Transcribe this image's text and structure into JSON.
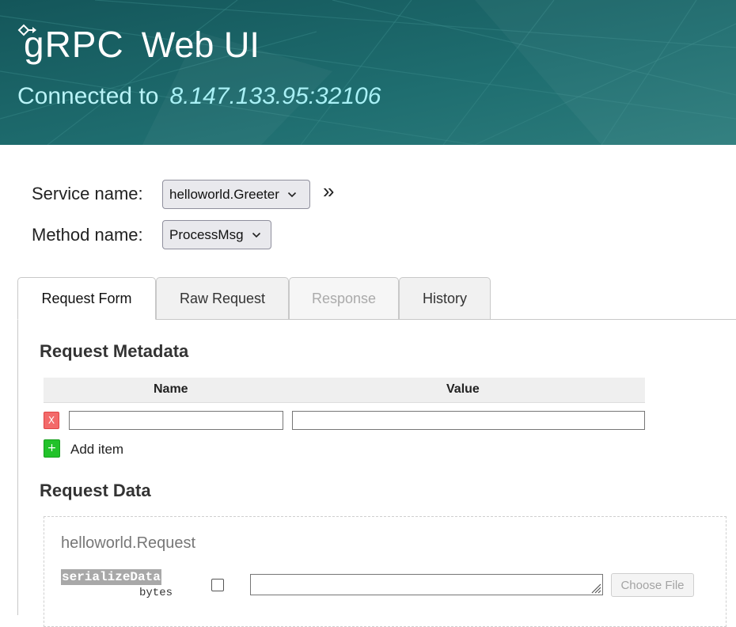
{
  "header": {
    "logo_text": "gRPC",
    "app_title": "Web UI",
    "connected_label": "Connected to",
    "host": "8.147.133.95:32106",
    "bg_color": "#1d6a6d",
    "host_color": "#a8f0f5"
  },
  "selectors": {
    "service_label": "Service name:",
    "service_value": "helloworld.Greeter",
    "method_label": "Method name:",
    "method_value": "ProcessMsg",
    "expand_glyph": "»"
  },
  "tabs": [
    {
      "label": "Request Form",
      "state": "active"
    },
    {
      "label": "Raw Request",
      "state": "normal"
    },
    {
      "label": "Response",
      "state": "disabled"
    },
    {
      "label": "History",
      "state": "normal"
    }
  ],
  "metadata": {
    "title": "Request Metadata",
    "columns": [
      "Name",
      "Value"
    ],
    "row": {
      "remove_label": "X",
      "name_value": "",
      "value_value": ""
    },
    "add_label": "+",
    "add_item_text": "Add item"
  },
  "request_data": {
    "title": "Request Data",
    "message_type": "helloworld.Request",
    "fields": [
      {
        "name": "serializeData",
        "type": "bytes",
        "checked": false,
        "value": "",
        "file_button": "Choose File"
      }
    ]
  }
}
